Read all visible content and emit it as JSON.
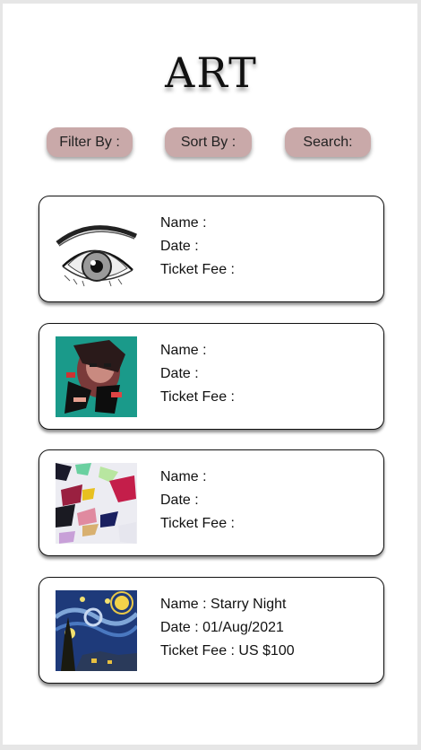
{
  "page": {
    "title": "ART"
  },
  "toolbar": {
    "filter_label": "Filter By :",
    "sort_label": "Sort By :",
    "search_label": "Search:"
  },
  "artworks": [
    {
      "image": "eye-sketch",
      "name_label": "Name :",
      "date_label": "Date :",
      "fee_label": "Ticket Fee :"
    },
    {
      "image": "abstract-portrait",
      "name_label": "Name :",
      "date_label": "Date :",
      "fee_label": "Ticket Fee :"
    },
    {
      "image": "abstract-brushstrokes",
      "name_label": "Name :",
      "date_label": "Date :",
      "fee_label": "Ticket Fee :"
    },
    {
      "image": "starry-night",
      "name_label": "Name : Starry Night",
      "date_label": "Date : 01/Aug/2021",
      "fee_label": "Ticket Fee : US $100"
    }
  ],
  "colors": {
    "pill_background": "#c9a9a9",
    "page_background": "#ffffff"
  }
}
